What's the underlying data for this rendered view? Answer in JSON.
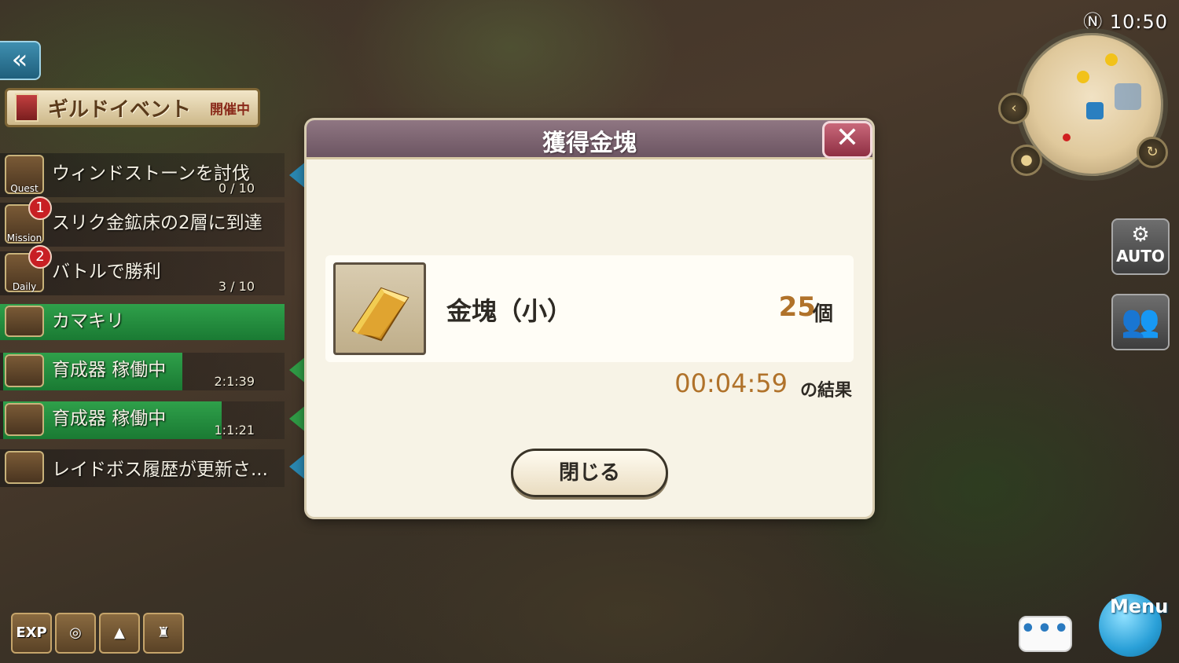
{
  "hud": {
    "clock": "10:50",
    "guild_banner": {
      "title": "ギルドイベント",
      "status": "開催中"
    },
    "tasks": [
      {
        "text": "ウィンドストーンを討伐",
        "progress": "0 / 10",
        "caption": "Quest",
        "badge": ""
      },
      {
        "text": "スリク金鉱床の2層に到達",
        "progress": "",
        "caption": "Mission",
        "badge": "1"
      },
      {
        "text": "バトルで勝利",
        "progress": "3 / 10",
        "caption": "Daily",
        "badge": "2"
      },
      {
        "text": "カマキリ",
        "progress": "",
        "caption": "",
        "badge": ""
      },
      {
        "text": "育成器 稼働中",
        "progress": "2:1:39",
        "caption": "",
        "badge": ""
      },
      {
        "text": "育成器 稼働中",
        "progress": "1:1:21",
        "caption": "",
        "badge": ""
      },
      {
        "text": "レイドボス履歴が更新さ...",
        "progress": "",
        "caption": "",
        "badge": ""
      }
    ],
    "bottom_icons": [
      "EXP"
    ],
    "auto_label": "AUTO",
    "menu_label": "Menu",
    "chat_label": "•••"
  },
  "dialog": {
    "title": "獲得金塊",
    "close_glyph": "✕",
    "item_name": "金塊（小）",
    "item_quantity": "25",
    "item_unit": "個",
    "result_time": "00:04:59",
    "result_suffix": "の結果",
    "close_button": "閉じる"
  },
  "colors": {
    "dialog_header": "#7b6470",
    "accent_gold": "#b0722a",
    "task_green": "#2fa04a"
  }
}
